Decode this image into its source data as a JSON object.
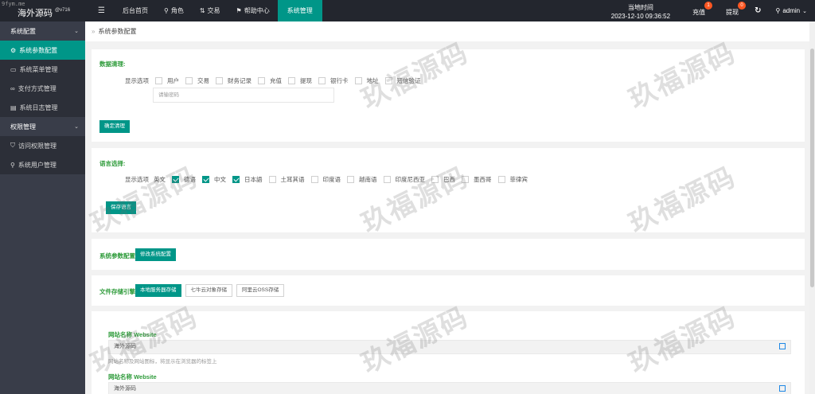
{
  "header": {
    "watermark_url": "9fym.me",
    "logo_title": "海外源码",
    "logo_version": "@v716",
    "menu_icon": "hamburger-icon",
    "nav": [
      {
        "label": "后台首页",
        "icon": ""
      },
      {
        "label": "角色",
        "icon": "user-icon"
      },
      {
        "label": "交易",
        "icon": "swap-icon"
      },
      {
        "label": "帮助中心",
        "icon": "flag-icon"
      },
      {
        "label": "系统管理",
        "icon": "",
        "active": true
      }
    ],
    "time_label": "当地时间",
    "time_value": "2023-12-10 09:36:52",
    "recharge_label": "充值",
    "recharge_count": "1",
    "withdraw_label": "提现",
    "withdraw_count": "0",
    "user_name": "admin",
    "accent_color": "#009688",
    "badge_color": "#ff5722"
  },
  "sidebar": {
    "groups": [
      {
        "label": "系统配置",
        "items": [
          {
            "label": "系统参数配置",
            "icon": "gear-icon",
            "active": true
          },
          {
            "label": "系统菜单管理",
            "icon": "window-icon"
          },
          {
            "label": "支付方式管理",
            "icon": "link-icon"
          },
          {
            "label": "系统日志管理",
            "icon": "document-icon"
          }
        ]
      },
      {
        "label": "权限管理",
        "items": [
          {
            "label": "访问权限管理",
            "icon": "shield-icon"
          },
          {
            "label": "系统用户管理",
            "icon": "user-icon"
          }
        ]
      }
    ]
  },
  "breadcrumb": {
    "current": "系统参数配置"
  },
  "data_clear": {
    "title": "数据清理:",
    "row_label": "显示选项",
    "options": [
      "用户",
      "交易",
      "财务记录",
      "充值",
      "提现",
      "银行卡",
      "地址",
      "短信验证"
    ],
    "password_placeholder": "请输密码",
    "button": "确定清理"
  },
  "language": {
    "title": "语言选择:",
    "row_label": "显示选项",
    "options": [
      {
        "label": "英文",
        "checked": true
      },
      {
        "label": "德语",
        "checked": true
      },
      {
        "label": "中文",
        "checked": true
      },
      {
        "label": "日本語",
        "checked": false
      },
      {
        "label": "土耳其语",
        "checked": false
      },
      {
        "label": "印度语",
        "checked": false
      },
      {
        "label": "越南语",
        "checked": false
      },
      {
        "label": "印度尼西亚",
        "checked": false
      },
      {
        "label": "巴西",
        "checked": false
      },
      {
        "label": "墨西哥",
        "checked": false
      },
      {
        "label": "菲律宾",
        "checked": false
      }
    ],
    "button": "保存语言"
  },
  "system_params": {
    "title": "系统参数配置:",
    "button": "修改系统配置"
  },
  "storage": {
    "title": "文件存储引擎:",
    "buttons": [
      "本地服务器存储",
      "七牛云对象存储",
      "阿里云OSS存储"
    ]
  },
  "site": {
    "field1_label": "网站名称 Website",
    "field1_value": "海外源码",
    "field1_hint": "网站名称及网站图标，将显示在浏览器的标签上",
    "field2_label": "网站名称 Website",
    "field2_value": "海外源码"
  },
  "watermark_text": "玖福源码"
}
